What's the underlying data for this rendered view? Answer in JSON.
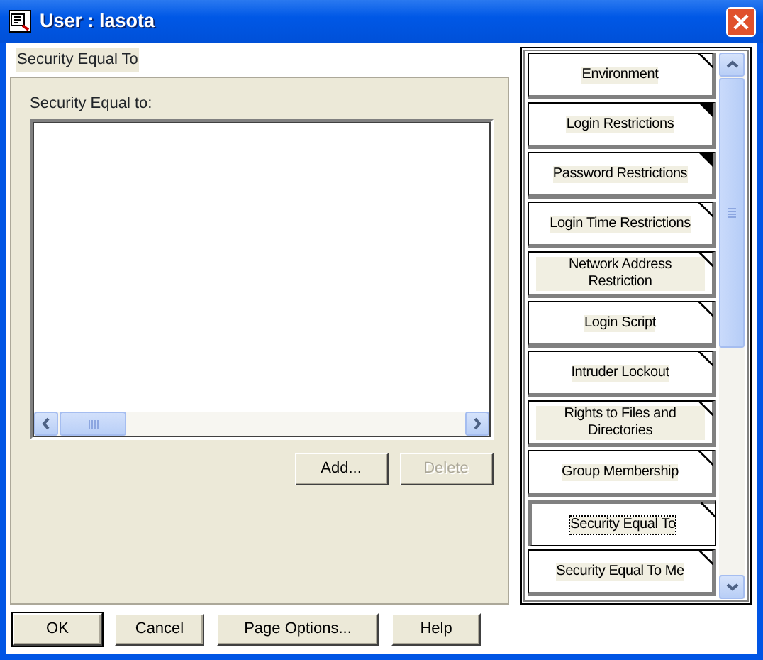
{
  "window": {
    "title": "User : lasota"
  },
  "page_title": "Security Equal To",
  "list_label": {
    "text": "Security Equal to:"
  },
  "list_buttons": [
    {
      "label": "Add...",
      "disabled": false
    },
    {
      "label": "Delete",
      "disabled": true
    }
  ],
  "pages": [
    {
      "label": "Environment",
      "flagged": false,
      "selected": false
    },
    {
      "label": "Login Restrictions",
      "flagged": true,
      "selected": false
    },
    {
      "label": "Password Restrictions",
      "flagged": true,
      "selected": false
    },
    {
      "label": "Login Time Restrictions",
      "flagged": false,
      "selected": false
    },
    {
      "label": "Network Address Restriction",
      "flagged": false,
      "selected": false
    },
    {
      "label": "Login Script",
      "flagged": false,
      "selected": false
    },
    {
      "label": "Intruder Lockout",
      "flagged": false,
      "selected": false
    },
    {
      "label": "Rights to Files and Directories",
      "flagged": false,
      "selected": false
    },
    {
      "label": "Group Membership",
      "flagged": false,
      "selected": false
    },
    {
      "label": "Security Equal To",
      "flagged": false,
      "selected": true
    },
    {
      "label": "Security Equal To Me",
      "flagged": false,
      "selected": false
    }
  ],
  "buttons": [
    {
      "label": "OK",
      "default": true
    },
    {
      "label": "Cancel",
      "default": false
    },
    {
      "label": "Page Options...",
      "default": false
    },
    {
      "label": "Help",
      "default": false
    }
  ]
}
